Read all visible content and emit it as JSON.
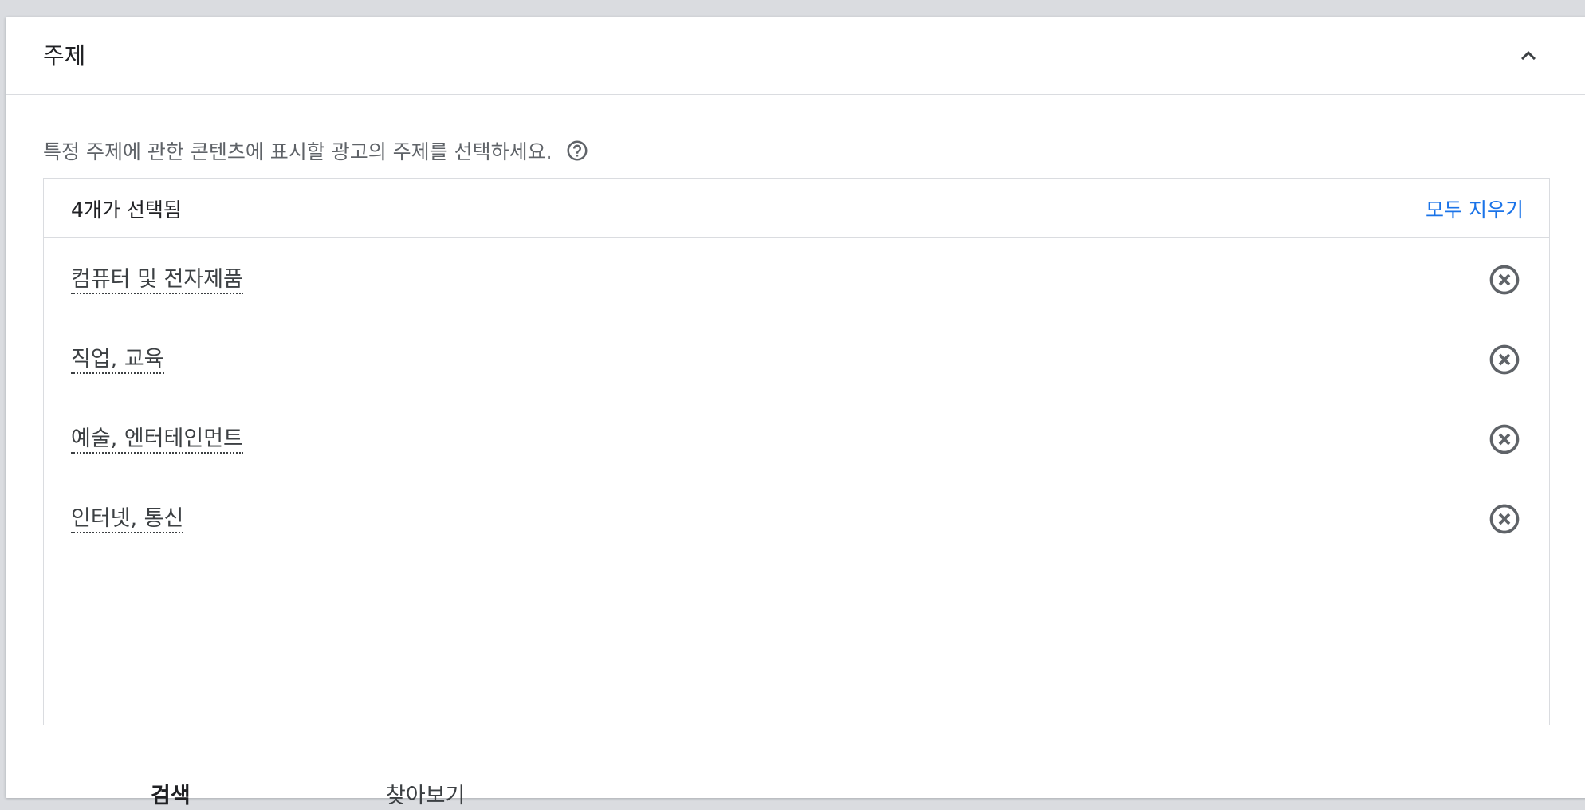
{
  "panel": {
    "title": "주제",
    "description": "특정 주제에 관한 콘텐츠에 표시할 광고의 주제를 선택하세요."
  },
  "selection": {
    "count_label": "4개가 선택됨",
    "clear_all_label": "모두 지우기",
    "items": [
      {
        "label": "컴퓨터 및 전자제품"
      },
      {
        "label": "직업, 교육"
      },
      {
        "label": "예술, 엔터테인먼트"
      },
      {
        "label": "인터넷, 통신"
      }
    ]
  },
  "tabs": {
    "search": "검색",
    "browse": "찾아보기"
  },
  "colors": {
    "accent": "#1a73e8",
    "border": "#dadce0",
    "text": "#3c4043"
  },
  "icons": {
    "collapse": "chevron-up-icon",
    "help": "help-circle-icon",
    "remove": "close-circle-icon"
  }
}
